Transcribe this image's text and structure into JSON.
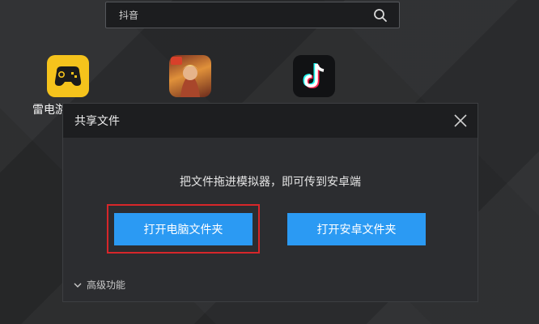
{
  "search": {
    "value": "抖音"
  },
  "desktop": {
    "apps": [
      {
        "label": "雷电游"
      },
      {
        "label": ""
      },
      {
        "label": ""
      }
    ]
  },
  "dialog": {
    "title": "共享文件",
    "hint": "把文件拖进模拟器，即可传到安卓端",
    "open_pc_folder": "打开电脑文件夹",
    "open_android_folder": "打开安卓文件夹",
    "advanced": "高级功能"
  },
  "colors": {
    "accent": "#2b9af3",
    "highlight": "#d7262a",
    "dialog_bg": "#2c2d30",
    "header_bg": "#1d1e20"
  },
  "icons": [
    "search-icon",
    "gamepad-icon",
    "hero-icon",
    "douyin-icon",
    "close-icon",
    "chevron-down-icon"
  ]
}
